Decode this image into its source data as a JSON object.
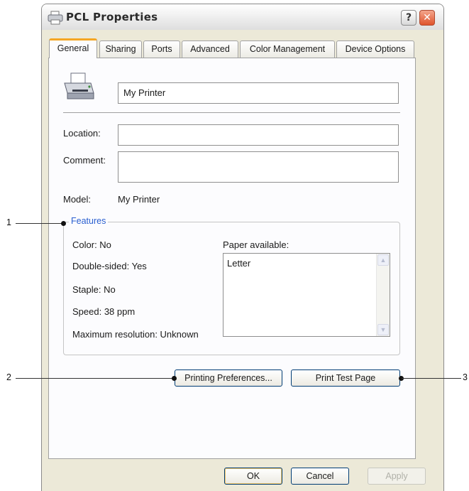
{
  "window": {
    "title": "PCL  Properties",
    "help_glyph": "?",
    "close_glyph": "✕"
  },
  "tabs": [
    {
      "label": "General",
      "active": true
    },
    {
      "label": "Sharing"
    },
    {
      "label": "Ports"
    },
    {
      "label": "Advanced"
    },
    {
      "label": "Color Management"
    },
    {
      "label": "Device Options"
    }
  ],
  "general": {
    "printer_name": "My Printer",
    "location_label": "Location:",
    "location_value": "",
    "comment_label": "Comment:",
    "comment_value": "",
    "model_label": "Model:",
    "model_value": "My Printer"
  },
  "features": {
    "title": "Features",
    "color": "Color: No",
    "double_sided": "Double-sided: Yes",
    "staple": "Staple: No",
    "speed": "Speed: 38 ppm",
    "max_resolution": "Maximum resolution: Unknown",
    "paper_label": "Paper available:",
    "paper_items": [
      "Letter"
    ]
  },
  "buttons": {
    "printing_preferences": "Printing Preferences...",
    "print_test_page": "Print Test Page",
    "ok": "OK",
    "cancel": "Cancel",
    "apply": "Apply"
  },
  "callouts": [
    "1",
    "2",
    "3"
  ],
  "colors": {
    "dialog_bg": "#ece9d8",
    "group_title": "#2a5fd0",
    "tab_highlight": "#f5a623",
    "close_button": "#e0542c"
  }
}
